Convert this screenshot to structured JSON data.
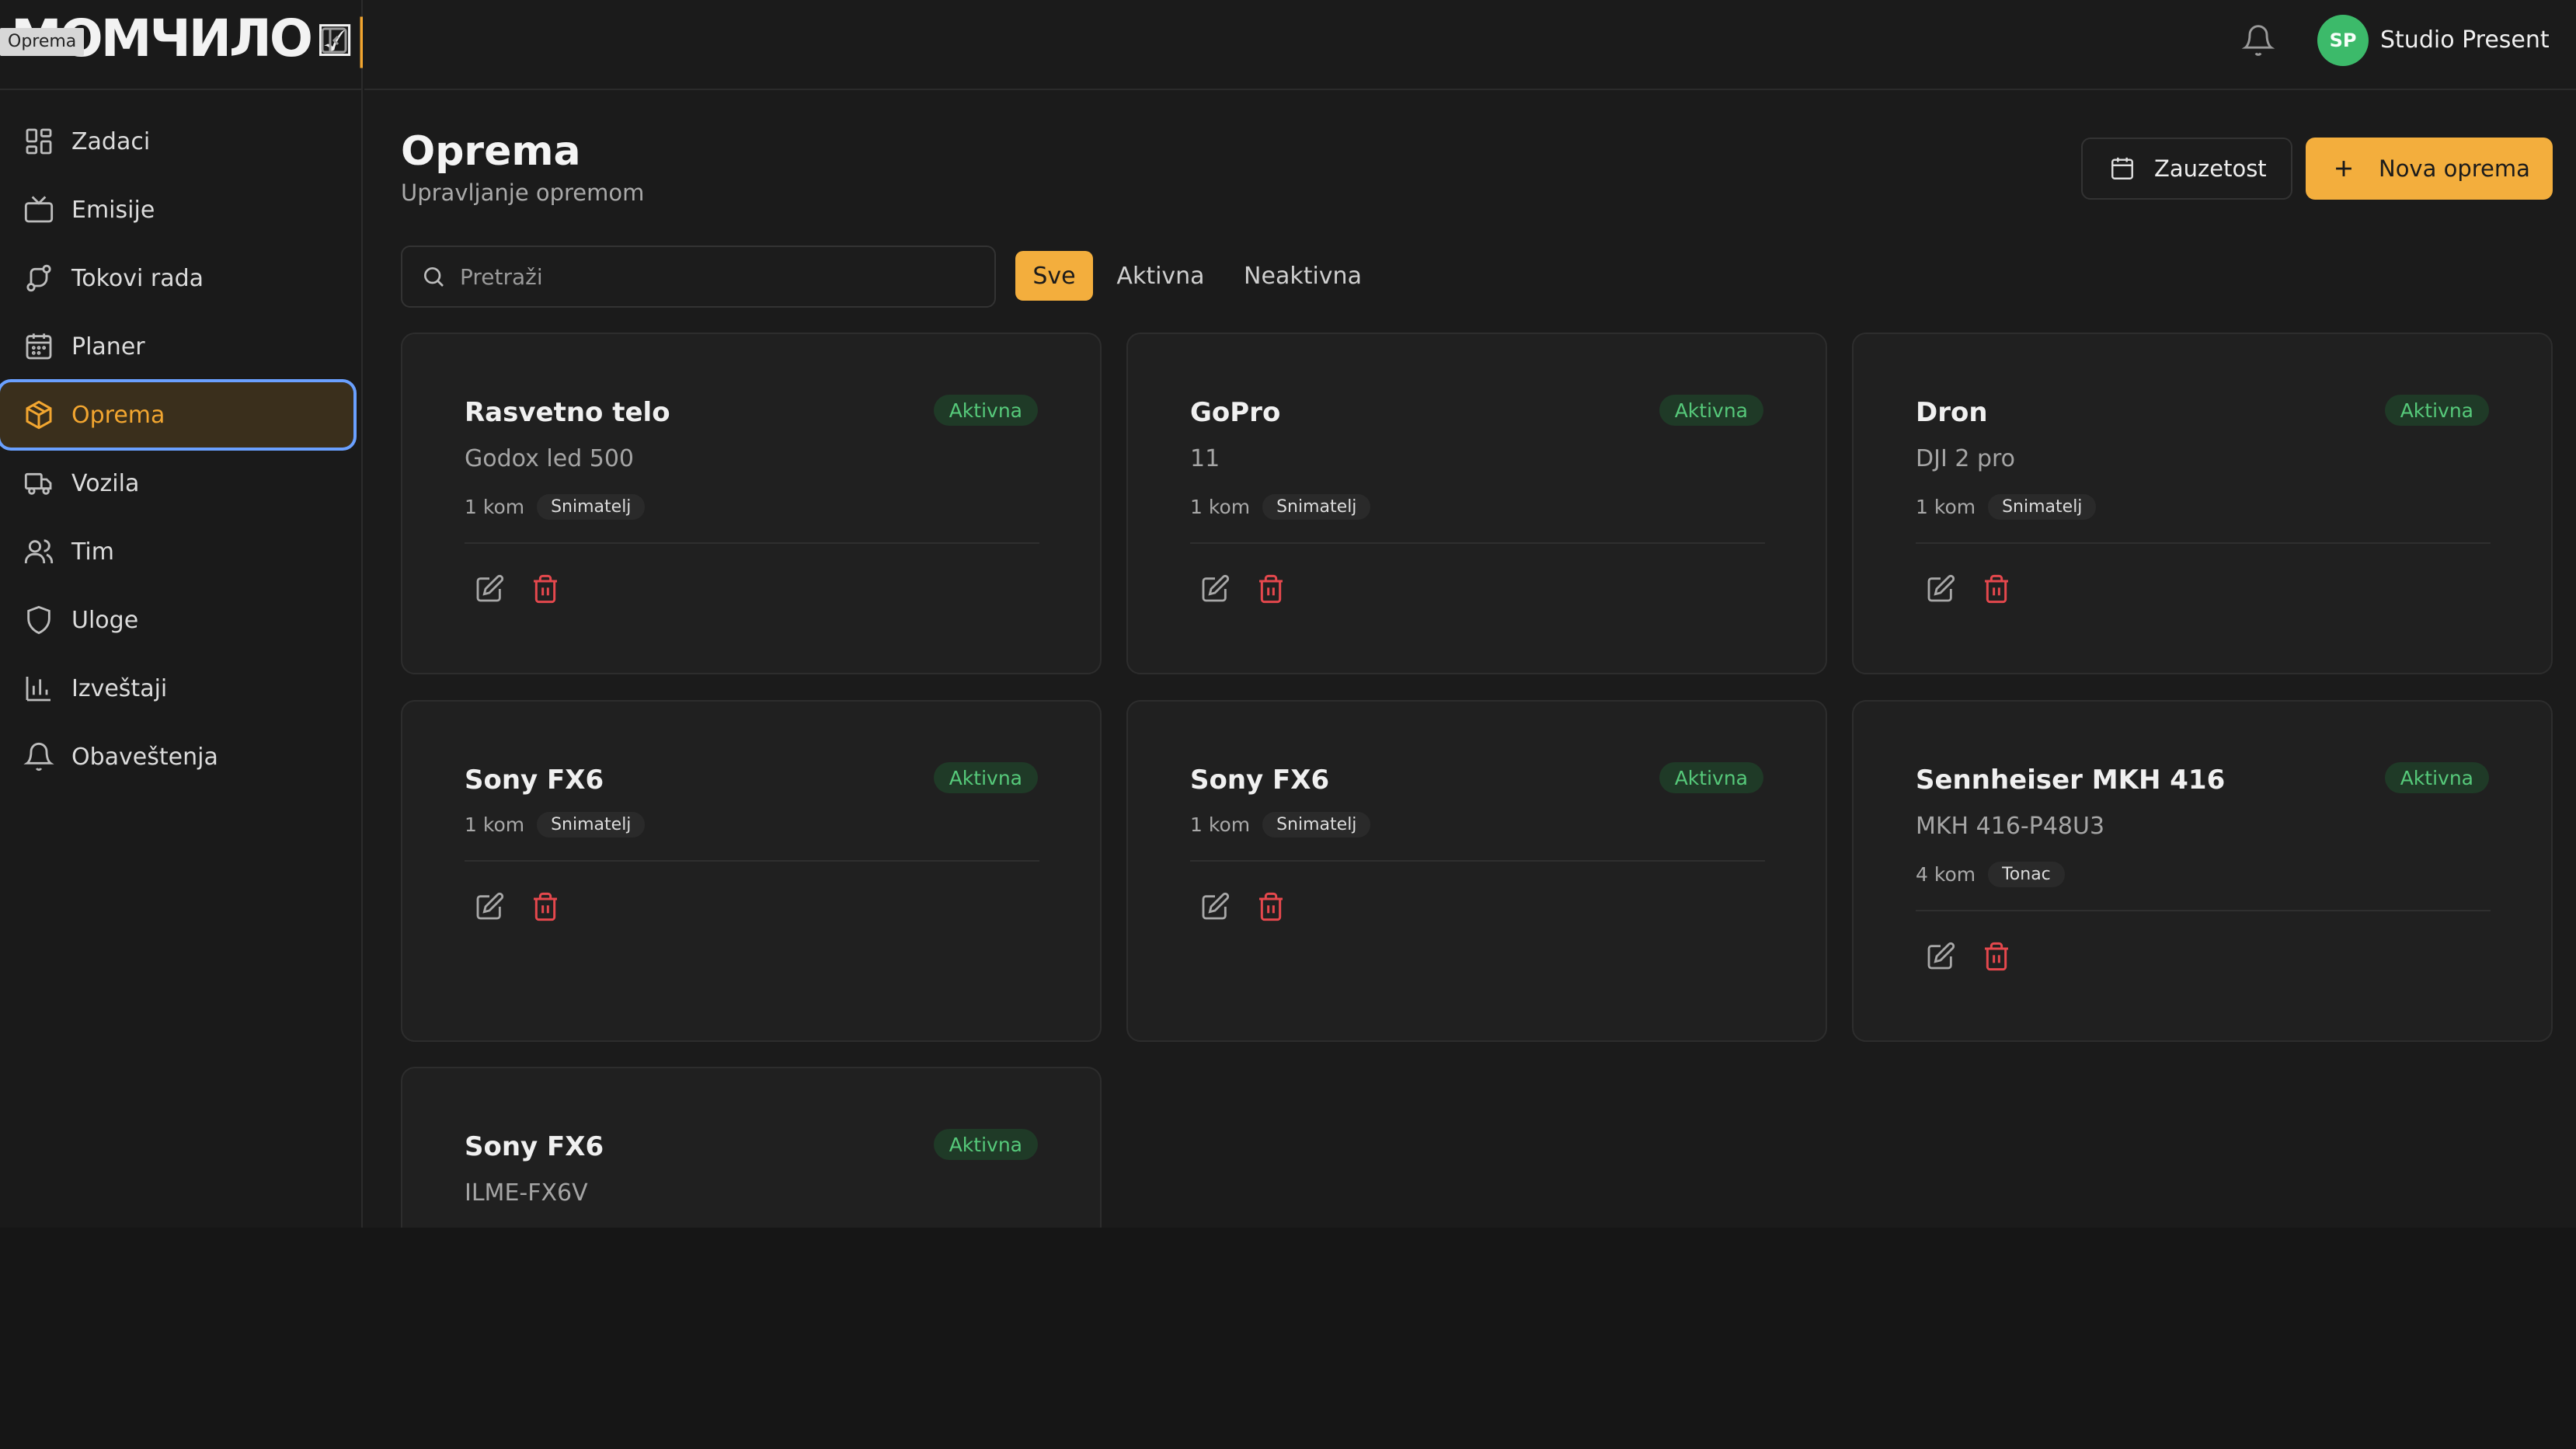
{
  "brand": {
    "logo_text": "МОМЧИЛО",
    "tooltip": "Oprema"
  },
  "sidebar": {
    "items": [
      {
        "label": "Zadaci",
        "icon": "grid-icon"
      },
      {
        "label": "Emisije",
        "icon": "tv-icon"
      },
      {
        "label": "Tokovi rada",
        "icon": "workflow-icon"
      },
      {
        "label": "Planer",
        "icon": "calendar-icon"
      },
      {
        "label": "Oprema",
        "icon": "package-icon",
        "active": true
      },
      {
        "label": "Vozila",
        "icon": "truck-icon"
      },
      {
        "label": "Tim",
        "icon": "users-icon"
      },
      {
        "label": "Uloge",
        "icon": "shield-icon"
      },
      {
        "label": "Izveštaji",
        "icon": "bar-chart-icon"
      },
      {
        "label": "Obaveštenja",
        "icon": "bell-icon"
      }
    ]
  },
  "topbar": {
    "user_initials": "SP",
    "user_name": "Studio Present"
  },
  "page": {
    "title": "Oprema",
    "subtitle": "Upravljanje opremom",
    "occupancy_label": "Zauzetost",
    "new_label": "Nova oprema"
  },
  "filters": {
    "search_placeholder": "Pretraži",
    "tabs": [
      {
        "label": "Sve",
        "active": true
      },
      {
        "label": "Aktivna"
      },
      {
        "label": "Neaktivna"
      }
    ]
  },
  "cards": [
    {
      "name": "Rasvetno telo",
      "status": "Aktivna",
      "model": "Godox led 500",
      "qty": "1 kom",
      "role": "Snimatelj"
    },
    {
      "name": "GoPro",
      "status": "Aktivna",
      "model": "11",
      "qty": "1 kom",
      "role": "Snimatelj"
    },
    {
      "name": "Dron",
      "status": "Aktivna",
      "model": "DJI 2 pro",
      "qty": "1 kom",
      "role": "Snimatelj"
    },
    {
      "name": "Sony FX6",
      "status": "Aktivna",
      "model": "",
      "qty": "1 kom",
      "role": "Snimatelj"
    },
    {
      "name": "Sony FX6",
      "status": "Aktivna",
      "model": "",
      "qty": "1 kom",
      "role": "Snimatelj"
    },
    {
      "name": "Sennheiser MKH 416",
      "status": "Aktivna",
      "model": "MKH 416-P48U3",
      "qty": "4 kom",
      "role": "Tonac"
    },
    {
      "name": "Sony FX6",
      "status": "Aktivna",
      "model": "ILME-FX6V",
      "qty": "",
      "role": ""
    }
  ],
  "colors": {
    "accent": "#f3ae3d",
    "status_green": "#56c97a",
    "danger": "#e5484d"
  }
}
